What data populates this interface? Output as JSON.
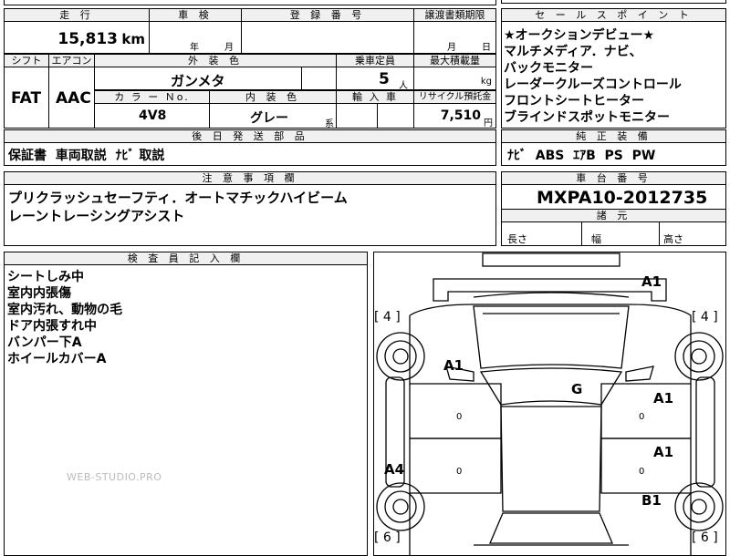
{
  "top": {
    "mileage_label": "走 行",
    "shaken_label": "車 検",
    "reg_label": "登 録 番 号",
    "transfer_label": "譲渡書類期限",
    "mileage": "15,813",
    "mileage_unit": "km",
    "shaken_year": "年",
    "shaken_month": "月",
    "transfer_month": "月",
    "transfer_day": "日"
  },
  "row2": {
    "shift_label": "シフト",
    "ac_label": "エアコン",
    "color_label": "外 装 色",
    "capacity_label": "乗車定員",
    "load_label": "最大積載量",
    "shift": "FAT",
    "ac": "AAC",
    "color": "ガンメタ",
    "capacity": "5",
    "capacity_unit": "人",
    "load_unit": "kg"
  },
  "row3": {
    "colorno_label": "カ ラ ー Ｎo.",
    "interior_label": "内 装 色",
    "import_label": "輸 入 車",
    "recycle_label": "リサイクル預託金",
    "colorno": "4V8",
    "interior": "グレー",
    "interior_unit": "系",
    "recycle": "7,510",
    "recycle_unit": "円"
  },
  "sales": {
    "label": "セ ー ル ス ポ イ ン ト",
    "lines": [
      "★オークションデビュー★",
      "マルチメディア．ナビ、",
      "バックモニター",
      "レーダークルーズコントロール",
      "フロントシートヒーター",
      "ブラインドスポットモニター"
    ]
  },
  "later_parts": {
    "label": "後 日 発 送 部 品",
    "value": "保証書  車両取説  ﾅﾋﾞ 取説"
  },
  "genuine": {
    "label": "純 正 装 備",
    "value": "ﾅﾋﾞ  ABS  ｴｱB  PS  PW"
  },
  "notes": {
    "label": "注 意 事 項 欄",
    "lines": [
      "プリクラッシュセーフティ．オートマチックハイビーム",
      "レーントレーシングアシスト"
    ]
  },
  "chassis": {
    "label": "車 台 番 号",
    "value": "MXPA10-2012735",
    "spec_label": "諸 元",
    "length": "長さ",
    "width": "幅",
    "height": "高さ"
  },
  "inspector": {
    "label": "検 査 員 記 入 欄",
    "lines": [
      "シートしみ中",
      "室内内張傷",
      "室内汚れ、動物の毛",
      "ドア内張すれ中",
      "バンパー下A",
      "ホイールカバーA"
    ]
  },
  "watermark": "WEB-STUDIO.PRO",
  "diagram": {
    "marks": [
      "A1",
      "A1",
      "G",
      "A1",
      "A1",
      "A4",
      "B1"
    ],
    "tires": [
      "[ 4 ]",
      "[ 4 ]",
      "[ 6 ]",
      "[ 6 ]"
    ],
    "zeros": [
      "0",
      "0",
      "0",
      "0"
    ]
  }
}
